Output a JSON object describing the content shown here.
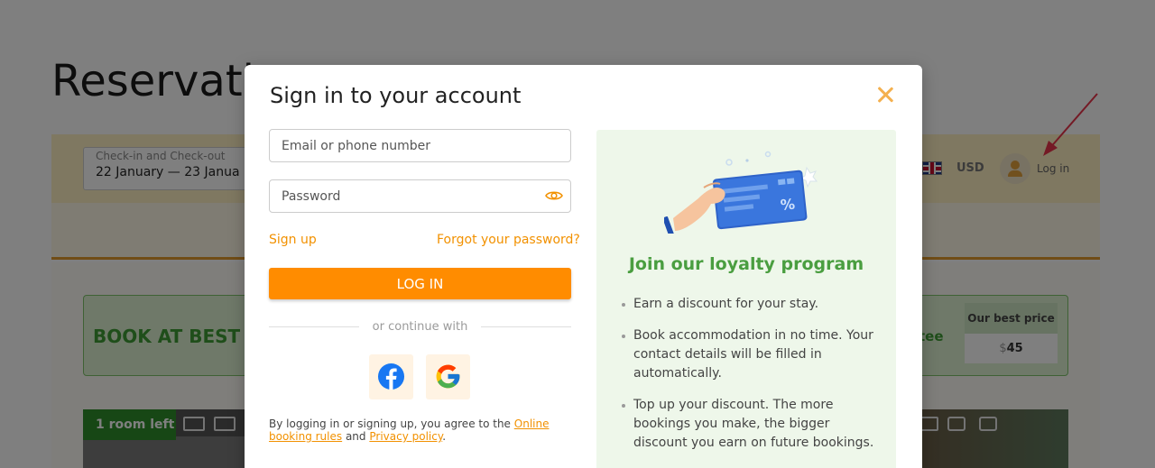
{
  "background": {
    "page_title": "Reservatio",
    "dates": {
      "label": "Check-in and Check-out",
      "value": "22 January — 23 Janua"
    },
    "currency": "USD",
    "login_link": "Log in",
    "promo": {
      "banner_text": "BOOK AT BEST P",
      "guarantee_text": "tee",
      "best_price_label": "Our best price",
      "currency_symbol": "$",
      "price_value": "45"
    },
    "room_badge": "1 room left",
    "colors": {
      "bar": "#fff0c2",
      "accent_orange": "#e39a2c",
      "promo_green": "#3e9c35"
    }
  },
  "modal": {
    "title": "Sign in to your account",
    "email_placeholder": "Email or phone number",
    "password_placeholder": "Password",
    "signup_link": "Sign up",
    "forgot_link": "Forgot your password?",
    "login_button": "LOG IN",
    "divider_text": "or continue with",
    "social": [
      {
        "name": "facebook",
        "icon": "facebook-icon"
      },
      {
        "name": "google",
        "icon": "google-icon"
      }
    ],
    "terms": {
      "prefix": "By logging in or signing up, you agree to the ",
      "rules_link": "Online booking rules",
      "and": " and ",
      "policy_link": "Privacy policy",
      "suffix": "."
    },
    "loyalty": {
      "title": "Join our loyalty program",
      "benefits": [
        "Earn a discount for your stay.",
        "Book accommodation in no time. Your contact details will be filled in automatically.",
        "Top up your discount. The more bookings you make, the bigger discount you earn on future bookings."
      ]
    },
    "colors": {
      "orange": "#ff8c00",
      "link": "#f29100",
      "panel_bg": "#eef7ea",
      "panel_title": "#4a9e40"
    }
  }
}
